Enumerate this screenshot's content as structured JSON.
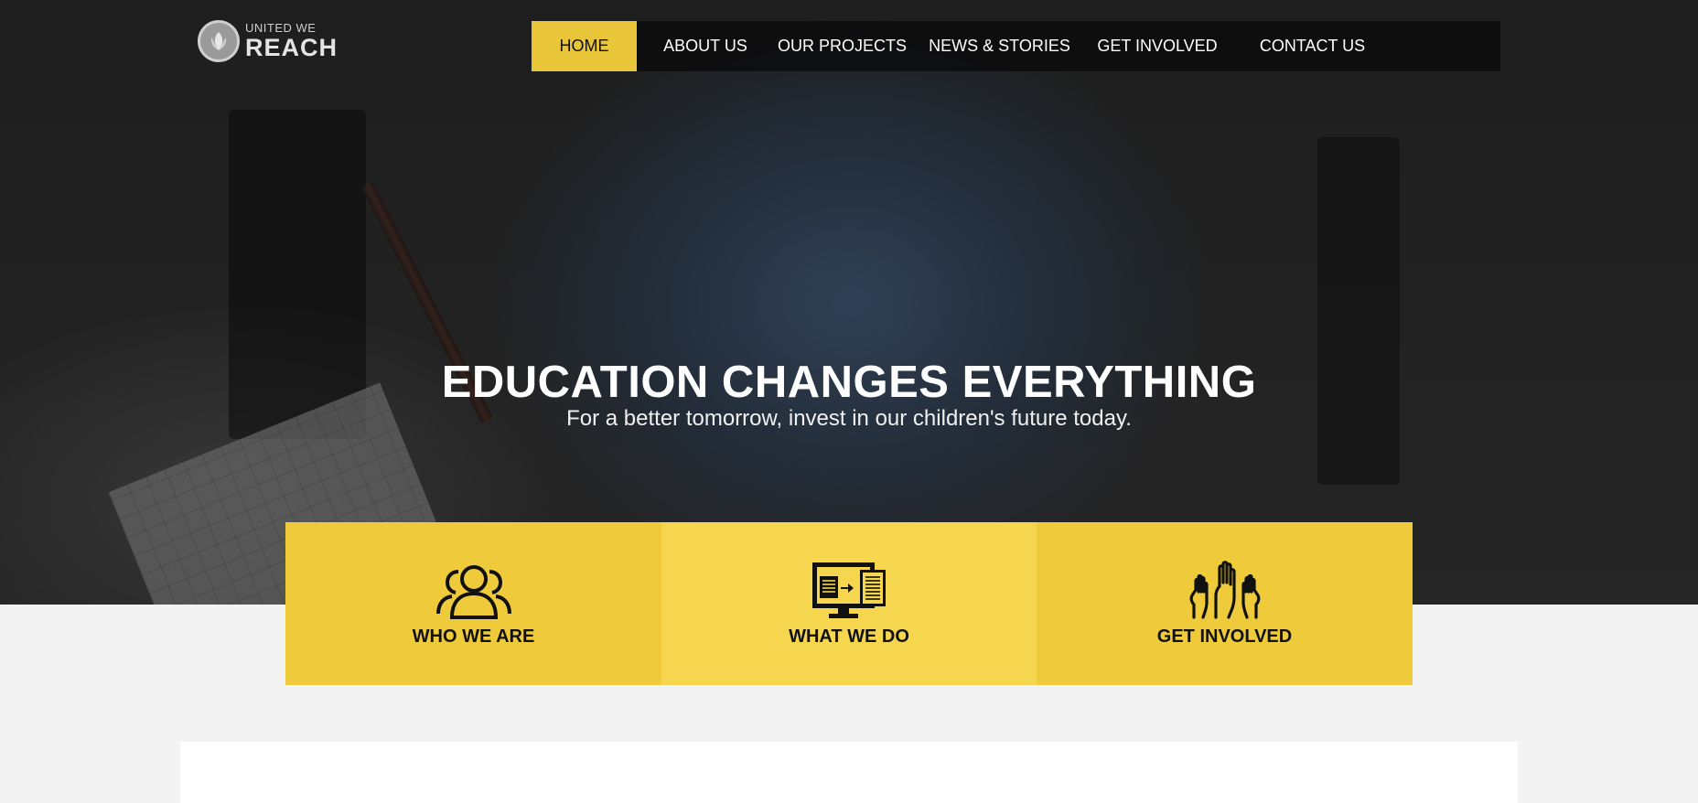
{
  "logo": {
    "small_text": "UNITED WE",
    "big_text": "REACH",
    "icon": "leaf-emblem-icon"
  },
  "nav": {
    "items": [
      {
        "label": "HOME",
        "active": true
      },
      {
        "label": "ABOUT US",
        "active": false
      },
      {
        "label": "OUR PROJECTS",
        "active": false
      },
      {
        "label": "NEWS & STORIES",
        "active": false
      },
      {
        "label": "GET INVOLVED",
        "active": false
      },
      {
        "label": "CONTACT US",
        "active": false
      }
    ],
    "active_color": "#e9c53a"
  },
  "hero": {
    "title": "EDUCATION CHANGES EVERYTHING",
    "subtitle": "For a better tomorrow, invest in our children's future today."
  },
  "features": [
    {
      "label": "WHO WE ARE",
      "icon": "people-group-icon"
    },
    {
      "label": "WHAT WE DO",
      "icon": "computer-documents-icon"
    },
    {
      "label": "GET INVOLVED",
      "icon": "raised-hands-icon"
    }
  ],
  "colors": {
    "accent": "#efcb3b",
    "accent_light": "#f6d54f",
    "page_background": "#f3f3f3"
  }
}
